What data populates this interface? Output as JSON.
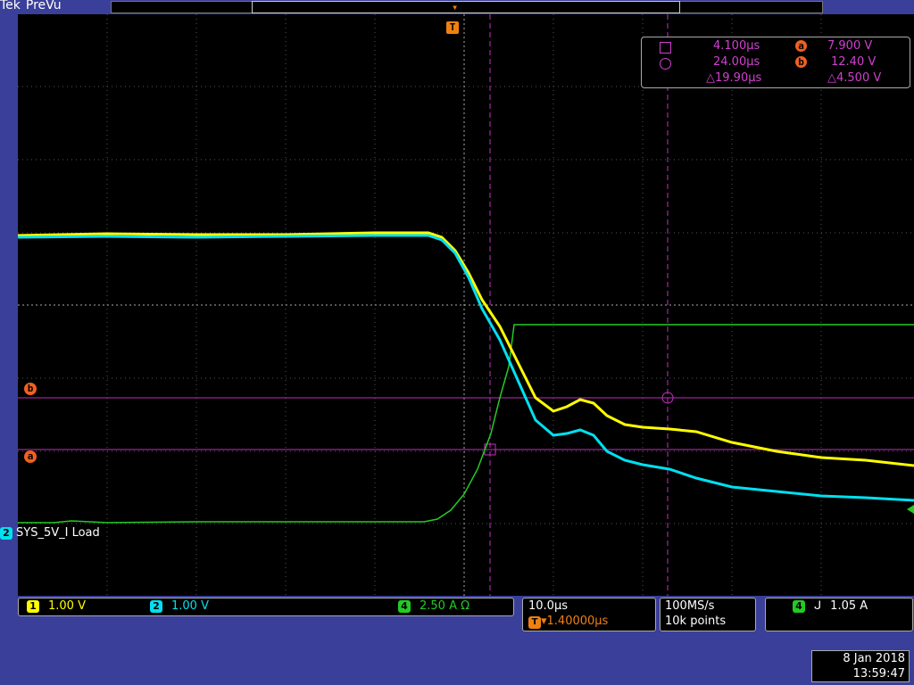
{
  "header": {
    "brand": "Tek",
    "mode": "PreVu"
  },
  "cursors": {
    "c1_time": "4.100µs",
    "c2_time": "24.00µs",
    "delta_time": "△19.90µs",
    "a_value": "7.900 V",
    "b_value": "12.40 V",
    "delta_value": "△4.500 V",
    "a_badge": "a",
    "b_badge": "b"
  },
  "waveform_label": "SYS_5V_I Load",
  "channels": [
    {
      "num": "1",
      "scale": "1.00 V",
      "color": "#ffff00"
    },
    {
      "num": "2",
      "scale": "1.00 V",
      "color": "#00e0f0"
    },
    {
      "num": "4",
      "scale": "2.50 A Ω",
      "color": "#22cc22"
    }
  ],
  "timebase": {
    "scale": "10.0µs",
    "position": "▾1.40000µs",
    "trigger_icon": "T"
  },
  "acquisition": {
    "rate": "100MS/s",
    "points": "10k points"
  },
  "trigger": {
    "channel": "4",
    "slope_icon": "rising-edge-icon",
    "level": "1.05 A"
  },
  "datetime": {
    "date": "8 Jan  2018",
    "time": "13:59:47"
  },
  "colors": {
    "ch1": "#ffff00",
    "ch2": "#00e0f0",
    "ch4": "#22cc22",
    "cursor": "#d040d0",
    "trigger": "#f08010"
  }
}
